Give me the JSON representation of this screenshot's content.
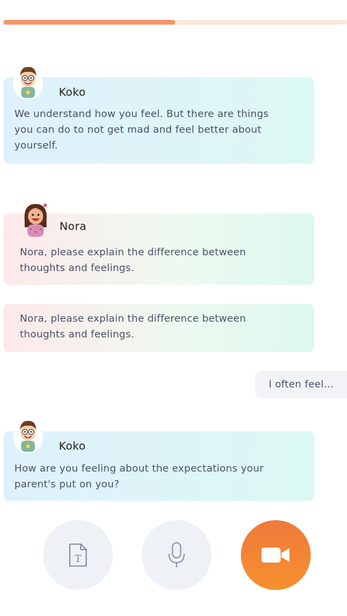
{
  "progress": {
    "fraction": 0.5
  },
  "messages": [
    {
      "sender": "Koko",
      "text_lines": [
        "We understand how you feel. But there are things",
        "you can do to not get mad and feel better about",
        "yourself."
      ]
    },
    {
      "sender": "Nora",
      "text_lines": [
        "Nora, please explain the difference between",
        "thoughts and feelings."
      ]
    },
    {
      "text_lines": [
        "Nora, please explain the difference between",
        "thoughts and feelings."
      ]
    },
    {
      "sender": "Koko",
      "text_lines": [
        "How are you feeling about the expectations your",
        "parent's put on you?"
      ]
    }
  ],
  "user_reply": {
    "text": "I often feel..."
  },
  "controls": {
    "text_icon": "text-file-icon",
    "mic_icon": "microphone-icon",
    "video_icon": "video-camera-icon"
  },
  "colors": {
    "accent": "#f5946a",
    "video_button": "#f08332",
    "koko_bubble": "#dff1fc",
    "nora_bubble": "#fde9ea"
  }
}
